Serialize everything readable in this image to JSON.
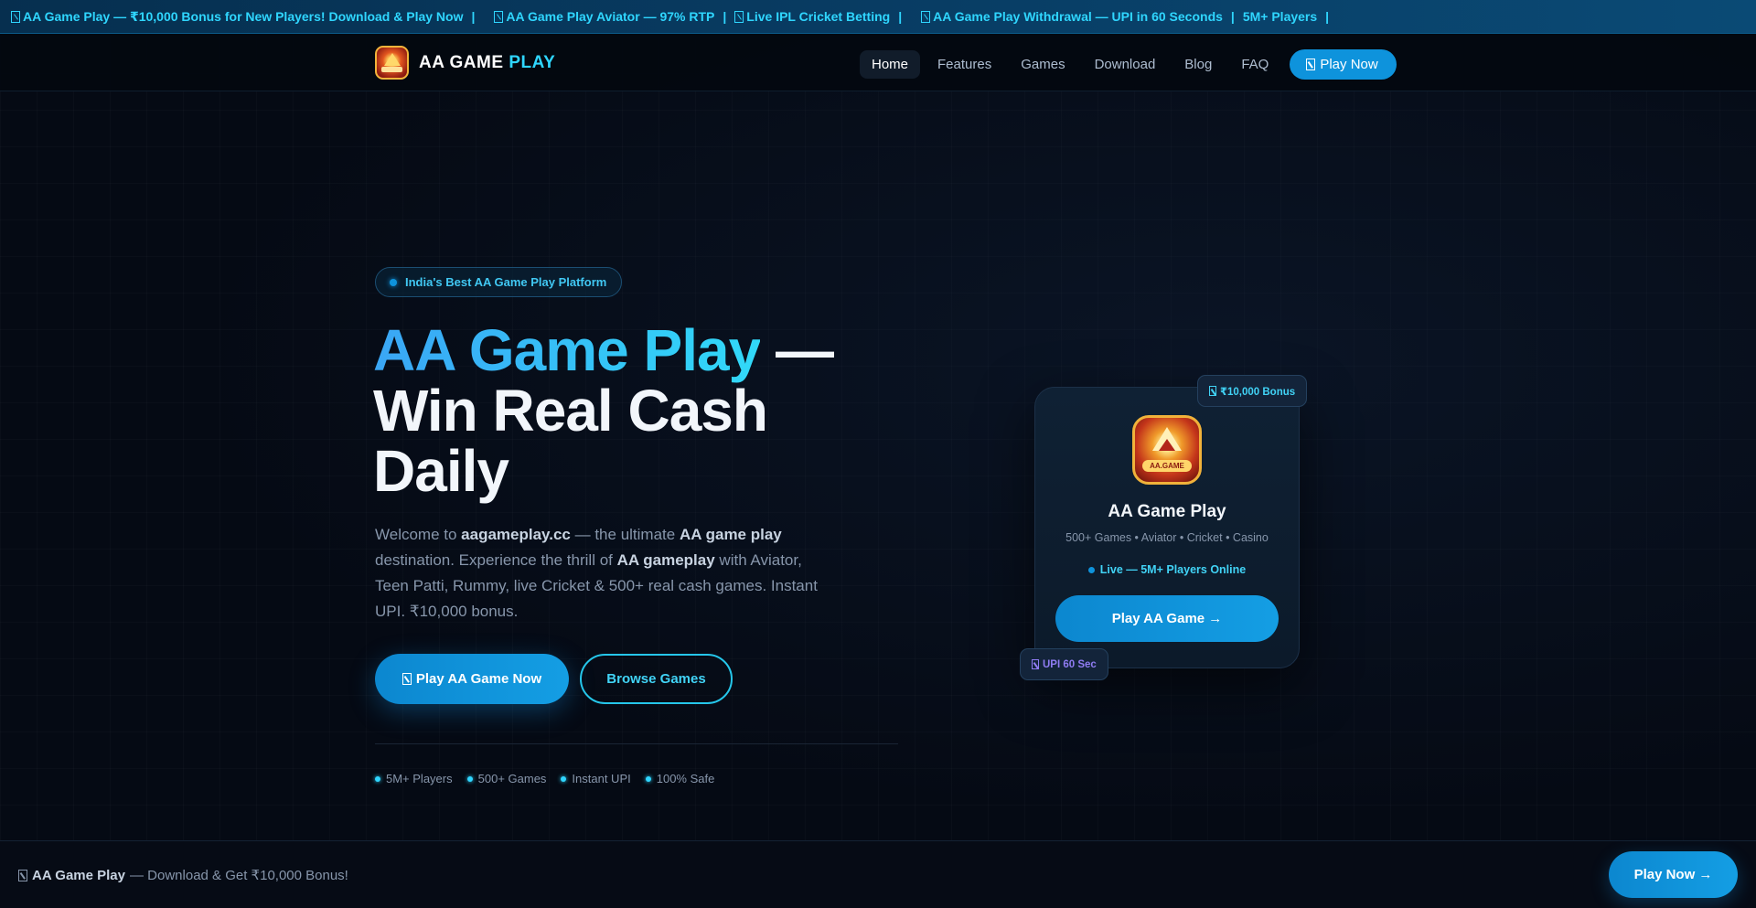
{
  "ticker": {
    "items": [
      "AA Game Play — ₹10,000 Bonus for New Players! Download & Play Now",
      "AA Game Play Aviator — 97% RTP",
      "Live IPL Cricket Betting",
      "AA Game Play Withdrawal — UPI in 60 Seconds",
      "5M+ Players"
    ],
    "separator": "|"
  },
  "header": {
    "logo_text_main": "AA GAME",
    "logo_text_accent": "PLAY",
    "nav": [
      "Home",
      "Features",
      "Games",
      "Download",
      "Blog",
      "FAQ"
    ],
    "active_nav": "Home",
    "cta_label": "Play Now"
  },
  "hero": {
    "badge": "India's Best AA Game Play Platform",
    "title_accent": "AA Game Play",
    "title_rest_1": " —",
    "title_rest_2": "Win Real Cash",
    "title_rest_3": "Daily",
    "desc": {
      "p1": "Welcome to ",
      "b1": "aagameplay.cc",
      "p2": " — the ultimate ",
      "b2": "AA game play",
      "p3": " destination. Experience the thrill of ",
      "b3": "AA gameplay",
      "p4": " with Aviator, Teen Patti, Rummy, live Cricket & 500+ real cash games. Instant UPI. ₹10,000 bonus."
    },
    "primary_button": "Play AA Game Now",
    "secondary_button": "Browse Games",
    "stats": [
      "5M+ Players",
      "500+ Games",
      "Instant UPI",
      "100% Safe"
    ]
  },
  "card": {
    "app_plate": "AA.GAME",
    "title": "AA Game Play",
    "subtitle": "500+ Games • Aviator • Cricket • Casino",
    "live": "Live — 5M+ Players Online",
    "button": "Play AA Game →",
    "bonus_badge": "₹10,000 Bonus",
    "upi_badge": "UPI 60 Sec"
  },
  "bottom_bar": {
    "brand": "AA Game Play",
    "text": "— Download & Get ₹10,000 Bonus!",
    "button": "Play Now →"
  },
  "colors": {
    "accent": "#2fd6ff",
    "primary": "#0e93dc",
    "background": "#050a14",
    "upi_badge": "#8f7cf2"
  }
}
